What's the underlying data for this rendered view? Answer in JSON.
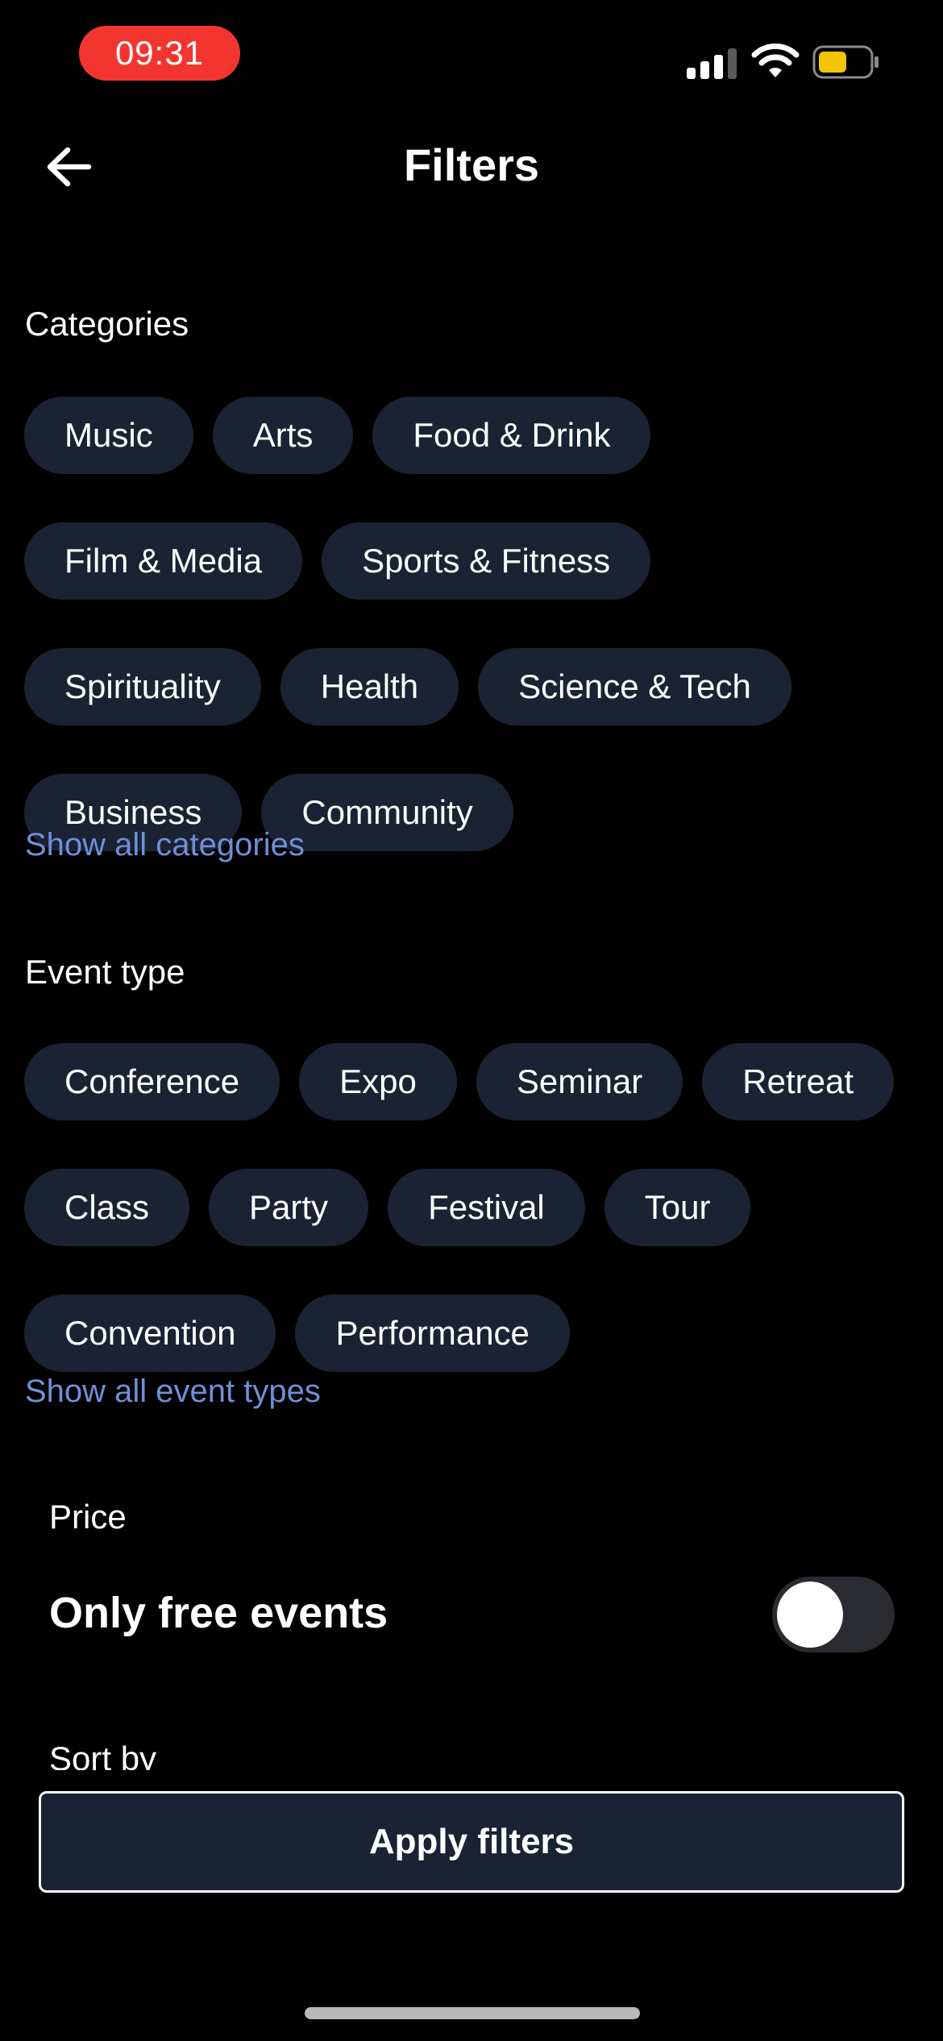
{
  "status_bar": {
    "time": "09:31",
    "time_pill_color": "#f2362f",
    "battery_color": "#f5c400"
  },
  "header": {
    "title": "Filters",
    "back_icon": "arrow-left-icon"
  },
  "categories": {
    "label": "Categories",
    "chips": [
      "Music",
      "Arts",
      "Food & Drink",
      "Film & Media",
      "Sports & Fitness",
      "Spirituality",
      "Health",
      "Science & Tech",
      "Business",
      "Community"
    ],
    "show_all": "Show all categories"
  },
  "event_type": {
    "label": "Event type",
    "chips": [
      "Conference",
      "Expo",
      "Seminar",
      "Retreat",
      "Class",
      "Party",
      "Festival",
      "Tour",
      "Convention",
      "Performance"
    ],
    "show_all": "Show all event types"
  },
  "price": {
    "label": "Price",
    "free_label": "Only free events",
    "free_only": false
  },
  "sort": {
    "label": "Sort by"
  },
  "apply_button": "Apply filters",
  "colors": {
    "background": "#000000",
    "chip": "#1b2233",
    "link": "#6f8fd8",
    "toggle_off": "#2a2b31"
  }
}
